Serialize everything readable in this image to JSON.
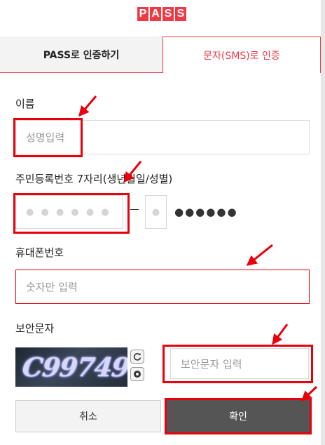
{
  "logo": {
    "letters": [
      "P",
      "A",
      "S",
      "S"
    ]
  },
  "tabs": [
    {
      "label": "PASS로 인증하기",
      "active": false
    },
    {
      "label": "문자(SMS)로 인증",
      "active": true
    }
  ],
  "form": {
    "name_label": "이름",
    "name_placeholder": "성명입력",
    "rrn_label": "주민등록번호 7자리(생년월일/성별)",
    "rrn_birth_dots": "● ● ● ● ● ●",
    "rrn_gender_dot": "●",
    "rrn_masked": "●●●●●●",
    "phone_label": "휴대폰번호",
    "phone_placeholder": "숫자만 입력",
    "captcha_label": "보안문자",
    "captcha_text": "C99749",
    "captcha_placeholder": "보안문자 입력"
  },
  "icons": {
    "refresh": "refresh-icon",
    "audio": "audio-icon"
  },
  "buttons": {
    "cancel": "취소",
    "confirm": "확인"
  },
  "colors": {
    "accent": "#ef3a45",
    "annotation": "#e8000b",
    "confirm_bg": "#555555",
    "cancel_bg": "#f3f3f3"
  }
}
